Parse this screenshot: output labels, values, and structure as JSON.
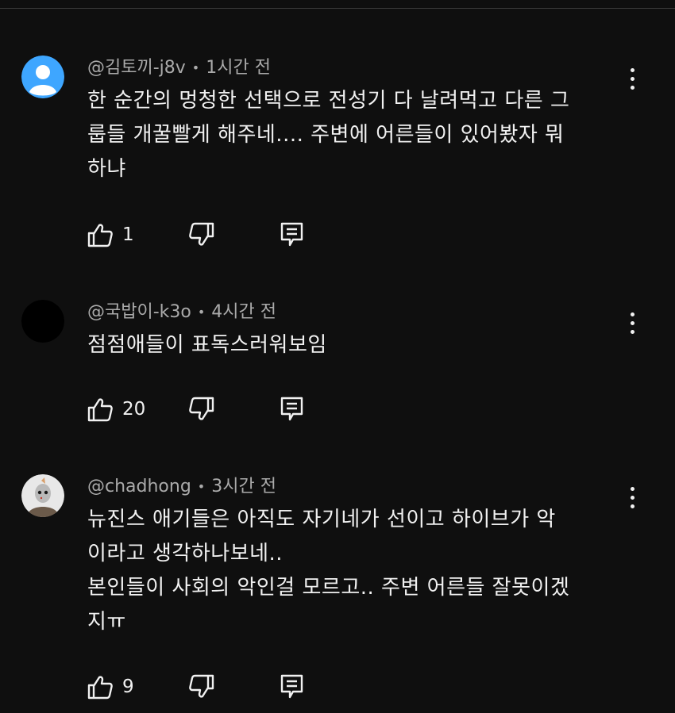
{
  "comments": [
    {
      "author": "@김토끼-j8v",
      "time": "1시간 전",
      "avatar": "default-user-avatar",
      "lines": [
        "한 순간의 멍청한 선택으로 전성기 다 날려먹고 다른 그",
        "룹들 개꿀빨게 해주네.... 주변에 어른들이 있어봤자 뭐",
        "하냐"
      ],
      "likes": "1"
    },
    {
      "author": "@국밥이-k3o",
      "time": "4시간 전",
      "avatar": "black-avatar",
      "lines": [
        "점점애들이 표독스러워보임"
      ],
      "likes": "20"
    },
    {
      "author": "@chadhong",
      "time": "3시간 전",
      "avatar": "character-avatar",
      "lines": [
        "뉴진스 애기들은 아직도 자기네가 선이고 하이브가 악",
        "이라고 생각하나보네..",
        "본인들이 사회의 악인걸 모르고.. 주변 어른들 잘못이겠",
        "지ㅠ"
      ],
      "likes": "9"
    }
  ],
  "separator": "•",
  "colors": {
    "background": "#0f0f0f",
    "text": "#f1f1f1",
    "meta": "#aaaaaa",
    "default_avatar": "#3ea6ff"
  }
}
